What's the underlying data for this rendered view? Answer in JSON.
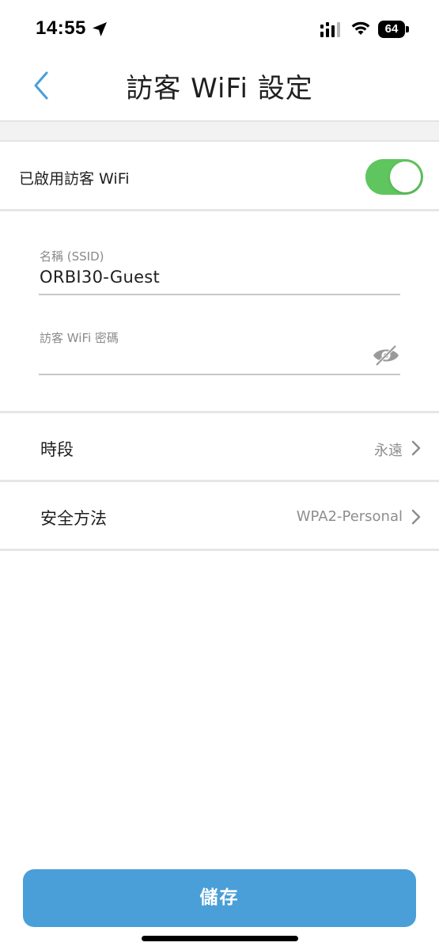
{
  "status_bar": {
    "time": "14:55",
    "battery": "64"
  },
  "nav": {
    "title": "訪客 WiFi 設定"
  },
  "guest_wifi": {
    "toggle_label": "已啟用訪客 WiFi",
    "enabled": true
  },
  "form": {
    "ssid_label": "名稱 (SSID)",
    "ssid_value": "ORBI30-Guest",
    "password_label": "訪客 WiFi 密碼",
    "password_value": ""
  },
  "rows": [
    {
      "label": "時段",
      "value": "永遠"
    },
    {
      "label": "安全方法",
      "value": "WPA2-Personal"
    }
  ],
  "actions": {
    "save_label": "儲存"
  },
  "colors": {
    "accent": "#4a9fd8",
    "toggle_on": "#5fc55e"
  }
}
